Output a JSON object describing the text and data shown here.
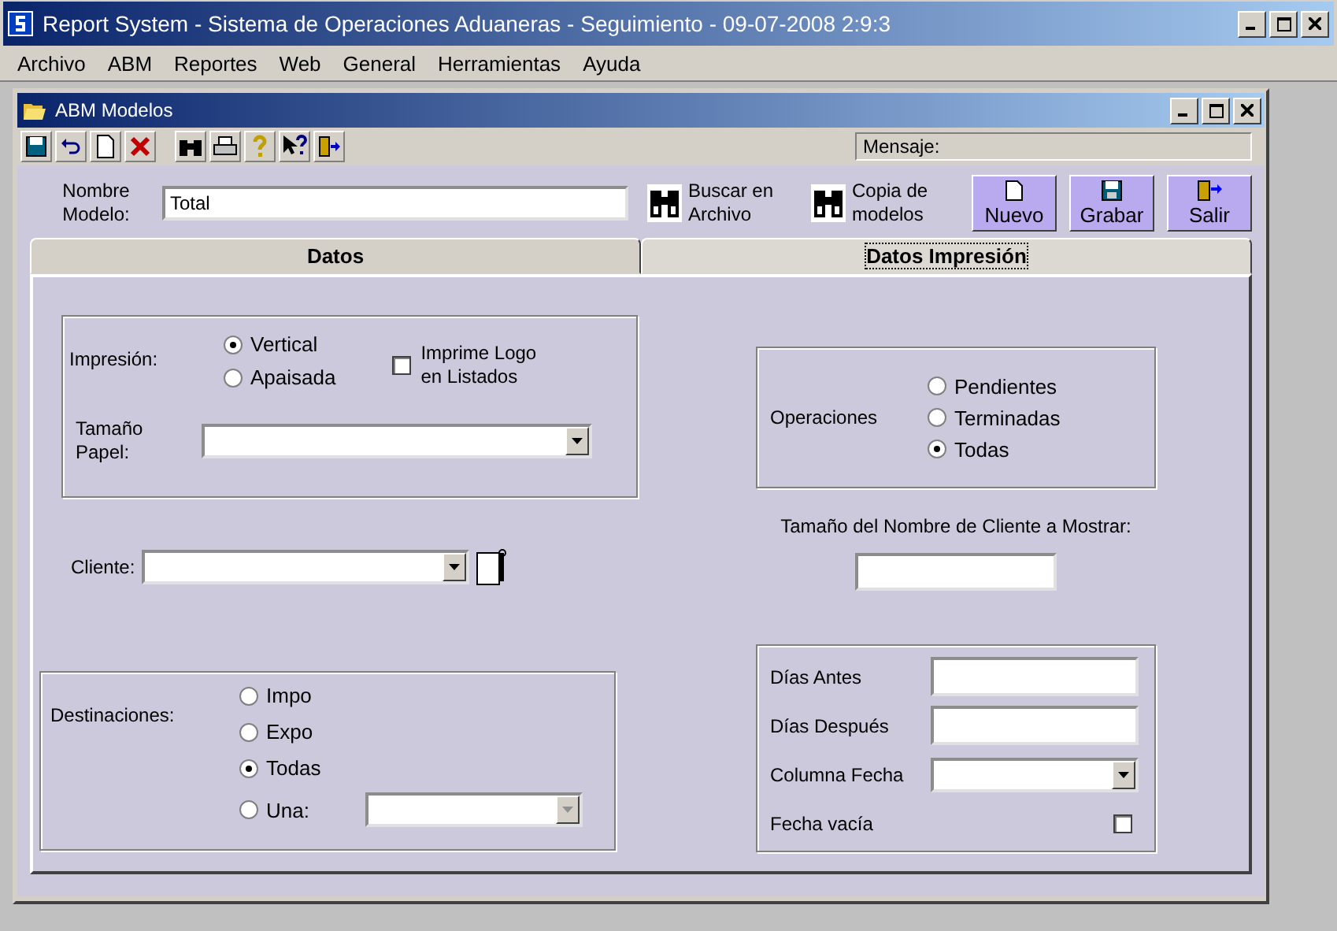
{
  "window": {
    "title": "Report System - Sistema de Operaciones Aduaneras - Seguimiento - 09-07-2008 2:9:3"
  },
  "menu": [
    "Archivo",
    "ABM",
    "Reportes",
    "Web",
    "General",
    "Herramientas",
    "Ayuda"
  ],
  "child_window": {
    "title": "ABM Modelos"
  },
  "toolbar": {
    "message_label": "Mensaje:"
  },
  "model_name": {
    "label": "Nombre Modelo:",
    "value": "Total"
  },
  "tools": [
    {
      "label": "Buscar en Archivo"
    },
    {
      "label": "Copia de modelos"
    }
  ],
  "buttons": [
    {
      "label": "Nuevo",
      "kind": "new"
    },
    {
      "label": "Grabar",
      "kind": "save"
    },
    {
      "label": "Salir",
      "kind": "exit"
    }
  ],
  "tabs": [
    {
      "label": "Datos",
      "selected": false
    },
    {
      "label": "Datos Impresión",
      "selected": true
    }
  ],
  "impresion": {
    "label": "Impresión:",
    "options": [
      {
        "label": "Vertical",
        "selected": true
      },
      {
        "label": "Apaisada",
        "selected": false
      }
    ],
    "logo": {
      "label": "Imprime Logo en Listados",
      "checked": false
    },
    "paper_label": "Tamaño Papel:"
  },
  "cliente": {
    "label": "Cliente:"
  },
  "destinaciones": {
    "label": "Destinaciones:",
    "options": [
      {
        "label": "Impo",
        "selected": false
      },
      {
        "label": "Expo",
        "selected": false
      },
      {
        "label": "Todas",
        "selected": true
      },
      {
        "label": "Una:",
        "selected": false
      }
    ],
    "una_combo": {
      "disabled": true
    }
  },
  "operaciones": {
    "label": "Operaciones",
    "options": [
      {
        "label": "Pendientes",
        "selected": false
      },
      {
        "label": "Terminadas",
        "selected": false
      },
      {
        "label": "Todas",
        "selected": true
      }
    ]
  },
  "client_name_size": {
    "label": "Tamaño del Nombre de Cliente a Mostrar:"
  },
  "fechas": {
    "dias_antes": "Días Antes",
    "dias_despues": "Días Después",
    "columna_fecha": "Columna Fecha",
    "fecha_vacia": {
      "label": "Fecha vacía",
      "checked": false
    }
  }
}
